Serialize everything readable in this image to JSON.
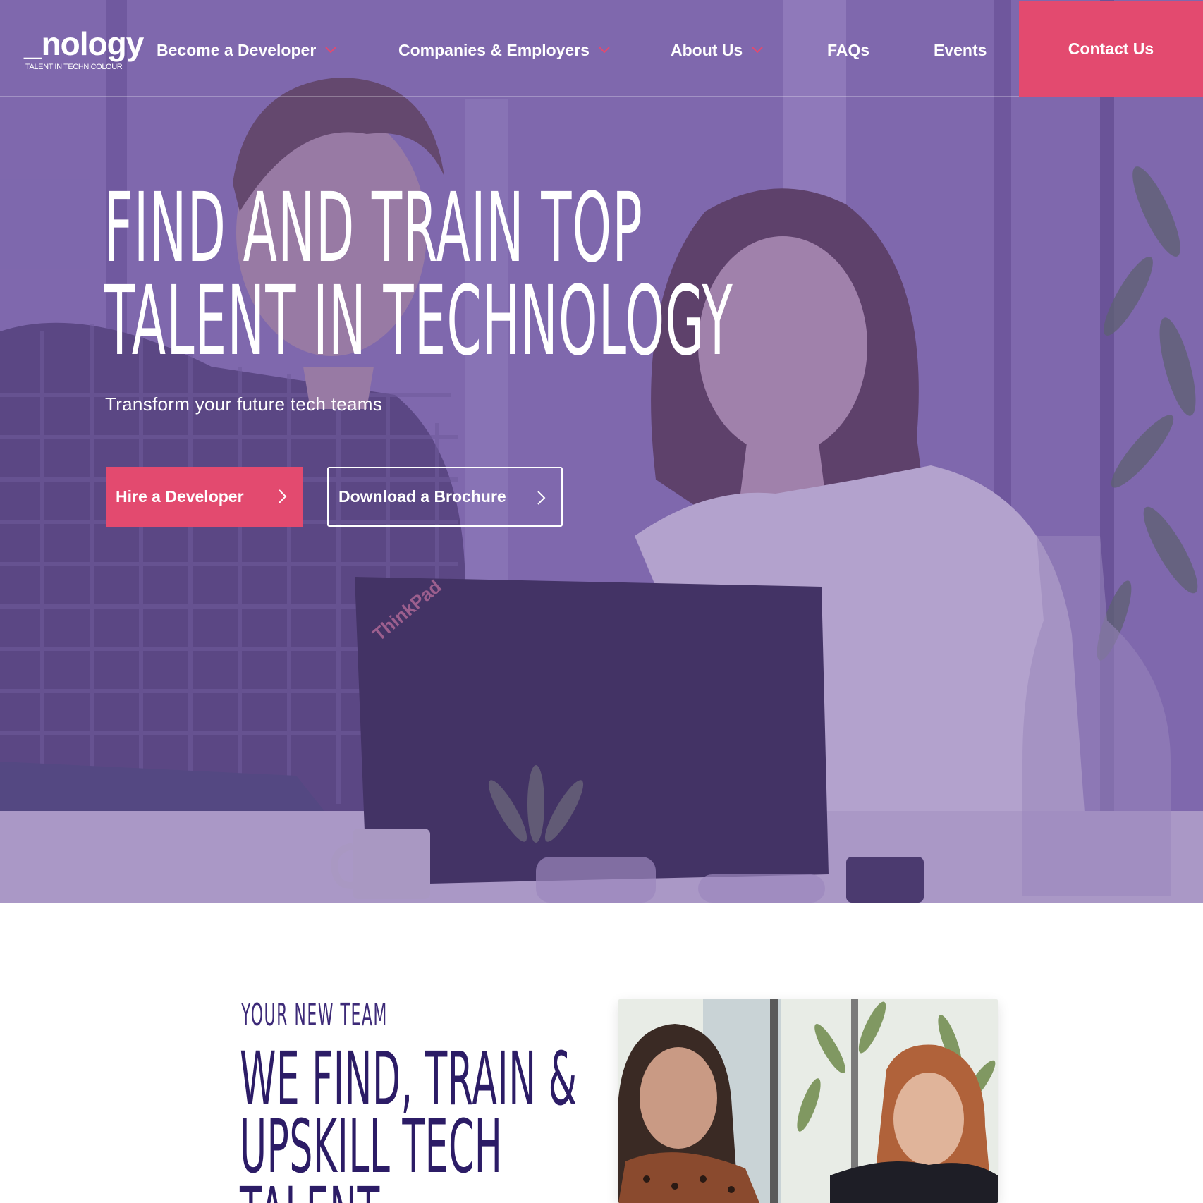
{
  "logo": {
    "wordmark": "_nology",
    "tagline": "TALENT IN TECHNICOLOUR"
  },
  "nav": {
    "items": [
      {
        "label": "Become a Developer",
        "has_dropdown": true
      },
      {
        "label": "Companies & Employers",
        "has_dropdown": true
      },
      {
        "label": "About Us",
        "has_dropdown": true
      },
      {
        "label": "FAQs",
        "has_dropdown": false
      },
      {
        "label": "Events",
        "has_dropdown": false
      }
    ],
    "contact_label": "Contact Us"
  },
  "hero": {
    "title_line1": "FIND AND TRAIN TOP",
    "title_line2": "TALENT IN TECHNOLOGY",
    "subtitle": "Transform your future tech teams",
    "primary_button": "Hire a Developer",
    "secondary_button": "Download a Brochure",
    "laptop_brand": "ThinkPad"
  },
  "section": {
    "eyebrow": "YOUR NEW TEAM",
    "title_line1": "WE FIND, TRAIN &",
    "title_line2": "UPSKILL TECH",
    "title_line3": "TALENT"
  },
  "colors": {
    "accent_pink": "#e34a6f",
    "hero_overlay": "#7054a0",
    "heading_purple": "#2c1c66",
    "text_white": "#ffffff"
  },
  "icons": {
    "dropdown": "chevron-down-icon",
    "button_arrow": "chevron-right-icon"
  }
}
